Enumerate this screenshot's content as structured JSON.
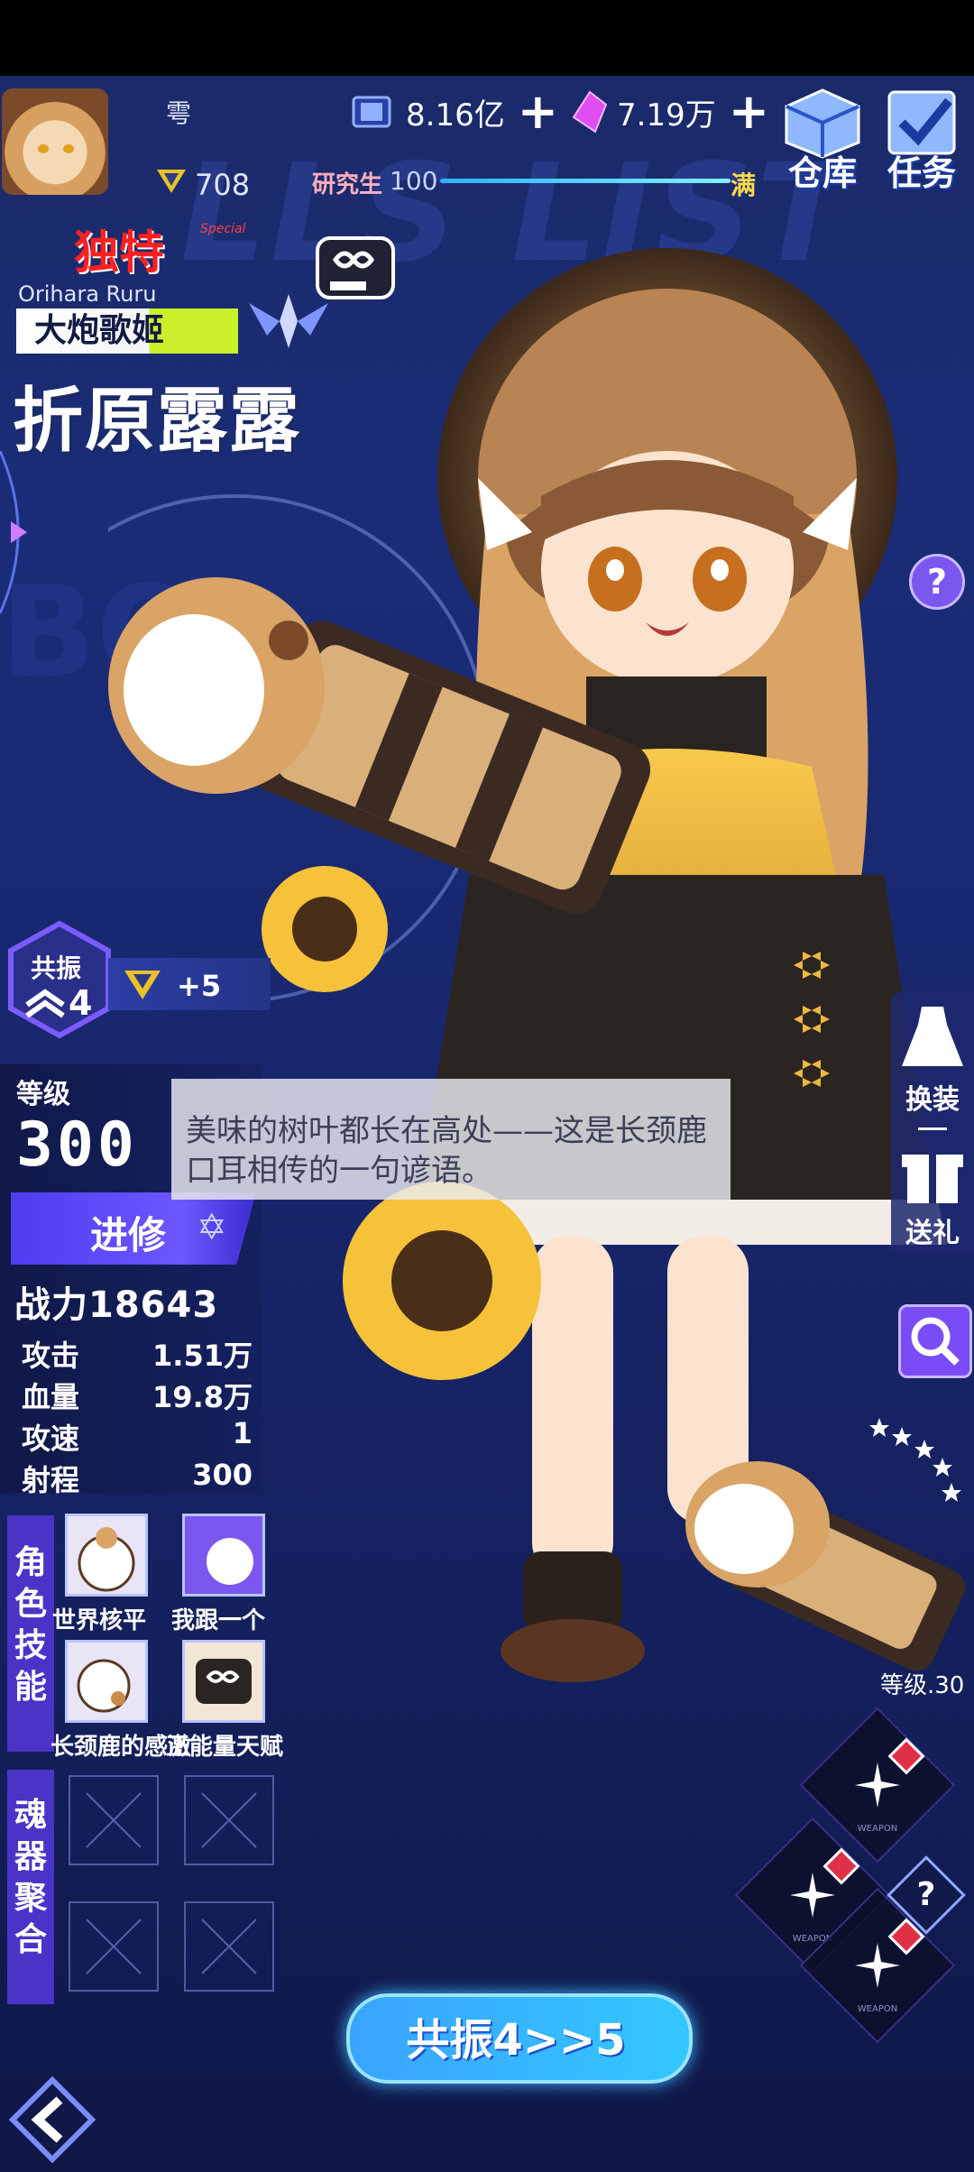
{
  "player": {
    "nickname": "雩",
    "level": "708"
  },
  "resources": [
    {
      "name": "coin",
      "icon": "coin-stack-icon",
      "value": "8.16亿"
    },
    {
      "name": "crystal",
      "icon": "crystal-icon",
      "value": "7.19万"
    }
  ],
  "exp": {
    "label": "研究生",
    "value": "100",
    "max_label": "满",
    "fill_ratio": 1.0
  },
  "top_buttons": {
    "warehouse": "仓库",
    "tasks": "任务"
  },
  "character": {
    "rarity": "独特",
    "rarity_sub": "Special",
    "english_name": "Orihara Ruru",
    "title": "大炮歌姬",
    "name": "折原露露"
  },
  "resonance": {
    "label": "共振",
    "level": "4",
    "bonus": "+5"
  },
  "stats": {
    "level_label": "等级",
    "level": "300",
    "advance_button": "进修",
    "power_label": "战力",
    "power": "18643",
    "rows": [
      {
        "label": "攻击",
        "value": "1.51万"
      },
      {
        "label": "血量",
        "value": "19.8万"
      },
      {
        "label": "攻速",
        "value": "1"
      },
      {
        "label": "射程",
        "value": "300"
      }
    ]
  },
  "dialogue": "美味的树叶都长在高处——这是长颈鹿口耳相传的一句谚语。",
  "skills": {
    "section_label": "角色技能",
    "items": [
      {
        "name": "世界核平",
        "icon": "giraffe-nuke-icon"
      },
      {
        "name": "我跟一个",
        "icon": "giraffe-dash-icon"
      },
      {
        "name": "长颈鹿的感激",
        "icon": "giraffe-thanks-icon"
      },
      {
        "name": "正能量天赋",
        "icon": "infinity-battery-icon"
      }
    ]
  },
  "soul": {
    "section_label": "魂器聚合",
    "slots": 4
  },
  "side_buttons": {
    "outfit": "换装",
    "gift": "送礼"
  },
  "help_button": "?",
  "pet": {
    "level_label": "等级.30"
  },
  "weapon_slots": [
    {
      "label": "WEAPON"
    },
    {
      "label": "WEAPON"
    },
    {
      "label": "WEAPON"
    }
  ],
  "weapon_help": "?",
  "resonance_button": "共振4>>5",
  "colors": {
    "accent": "#4f3cf0",
    "rarity": "#ff2020",
    "title_tag": "#c9f02a",
    "exp_bar": "#7ef3ff"
  }
}
